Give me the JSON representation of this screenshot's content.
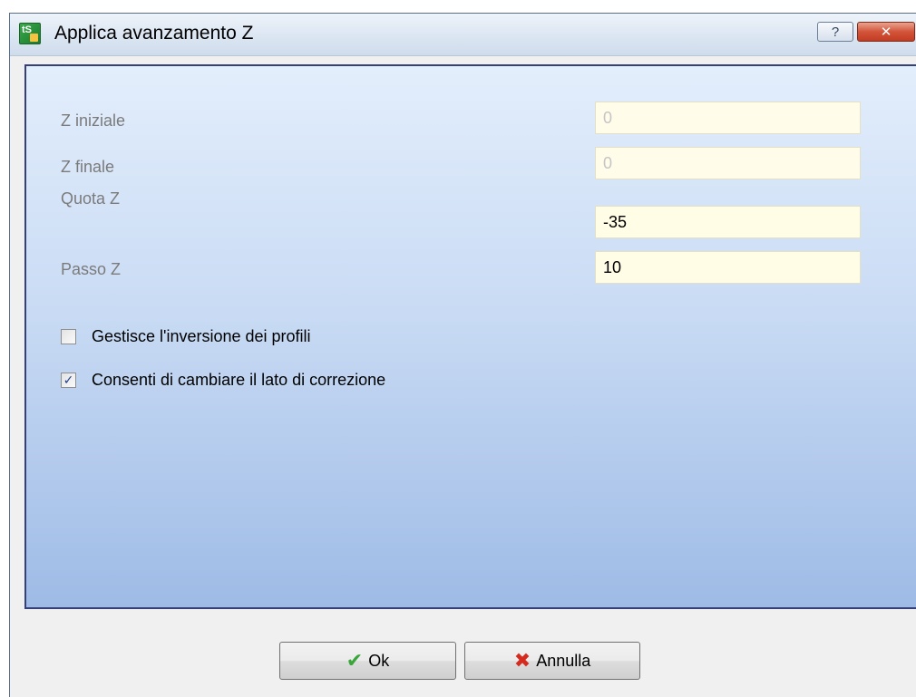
{
  "window": {
    "title": "Applica avanzamento Z",
    "help_glyph": "?",
    "close_glyph": "✕"
  },
  "fields": {
    "z_iniziale": {
      "label": "Z iniziale",
      "value": "0",
      "enabled": false
    },
    "z_finale": {
      "label": "Z finale",
      "value": "0",
      "enabled": false
    },
    "quota_z": {
      "label": "Quota Z",
      "value": "-35",
      "enabled": true
    },
    "passo_z": {
      "label": "Passo Z",
      "value": "10",
      "enabled": true
    }
  },
  "options": {
    "gestisce_inversione": {
      "label": "Gestisce l'inversione dei profili",
      "checked": false
    },
    "cambiare_lato": {
      "label": "Consenti di cambiare il lato di correzione",
      "checked": true
    }
  },
  "buttons": {
    "ok_label": "Ok",
    "ok_icon": "check-icon",
    "cancel_label": "Annulla",
    "cancel_icon": "cross-icon"
  },
  "colors": {
    "panel_border": "#35407a",
    "input_bg": "#fffde6",
    "disabled_text": "#c5c5c5",
    "ok_icon": "#3aa53a",
    "cancel_icon": "#d42b1e"
  }
}
